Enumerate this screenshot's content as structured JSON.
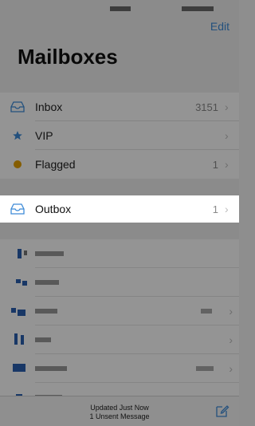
{
  "header": {
    "edit_label": "Edit",
    "title": "Mailboxes"
  },
  "mailboxes": [
    {
      "label": "Inbox",
      "count": "3151",
      "icon": "inbox-tray-icon"
    },
    {
      "label": "VIP",
      "count": "",
      "icon": "star-icon"
    },
    {
      "label": "Flagged",
      "count": "1",
      "icon": "flag-dot-icon"
    }
  ],
  "outbox": {
    "label": "Outbox",
    "count": "1",
    "icon": "outbox-tray-icon"
  },
  "footer": {
    "status": "Updated Just Now",
    "unsent": "1 Unsent Message"
  },
  "colors": {
    "accent": "#3d8bd8",
    "flag": "#e6a000",
    "dim_overlay": "rgba(0,0,0,0.42)"
  }
}
